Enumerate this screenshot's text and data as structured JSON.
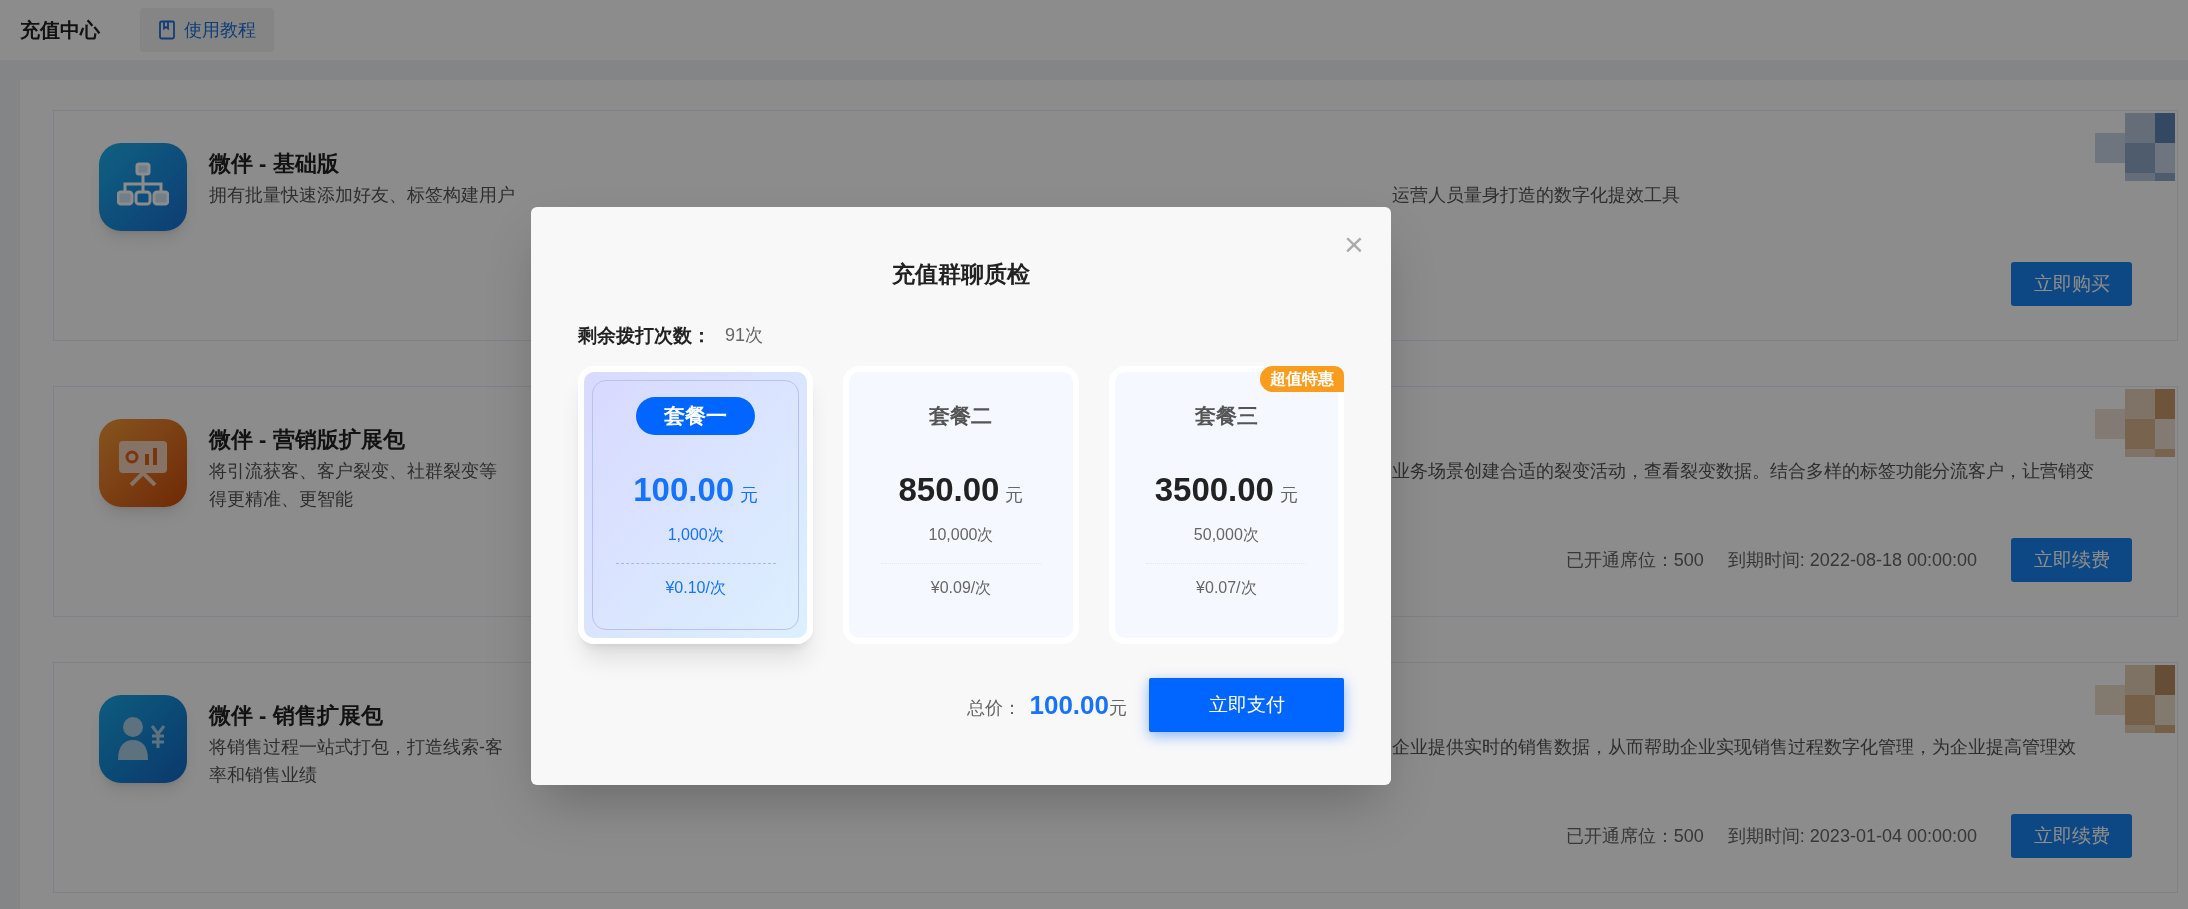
{
  "header": {
    "title": "充值中心",
    "tutorial_link": "使用教程"
  },
  "products": [
    {
      "kind": "network",
      "title": "微伴 - 基础版",
      "thumbnail": {
        "kind": "picture"
      },
      "lines": [
        {
          "left": "拥有批量快速添加好友、标签构建用户",
          "right": "运营人员量身打造的数字化提效工具"
        }
      ],
      "action": "立即购买"
    },
    {
      "kind": "presentation",
      "title": "微伴 - 营销版扩展包",
      "thumbnail": {
        "kind": "picture"
      },
      "lines": [
        {
          "left": "将引流获客、客户裂变、社群裂变等",
          "right": "业务场景创建合适的裂变活动，查看裂变数据。结合多样的标签功能分流客户，让营销变"
        },
        {
          "left": "得更精准、更智能"
        }
      ],
      "seats": "已开通席位：500",
      "expiry": "到期时间: 2022-08-18 00:00:00",
      "action": "立即续费"
    },
    {
      "kind": "sales",
      "title": "微伴 - 销售扩展包",
      "thumbnail": {
        "kind": "picture"
      },
      "lines": [
        {
          "left": "将销售过程一站式打包，打造线索-客",
          "right": "企业提供实时的销售数据，从而帮助企业实现销售过程数字化管理，为企业提高管理效"
        },
        {
          "left": "率和销售业绩"
        }
      ],
      "seats": "已开通席位：500",
      "expiry": "到期时间: 2023-01-04 00:00:00",
      "action": "立即续费"
    }
  ],
  "dialog": {
    "title": "充值群聊质检",
    "close": "×",
    "remaining_label": "剩余拨打次数：",
    "remaining_value": "91次",
    "plans": [
      {
        "name": "套餐一",
        "price": "100.00",
        "unit": "元",
        "count": "1,000次",
        "unit_price": "¥0.10/次",
        "selected": true
      },
      {
        "name": "套餐二",
        "price": "850.00",
        "unit": "元",
        "count": "10,000次",
        "unit_price": "¥0.09/次",
        "selected": false
      },
      {
        "name": "套餐三",
        "price": "3500.00",
        "unit": "元",
        "count": "50,000次",
        "unit_price": "¥0.07/次",
        "selected": false,
        "badge": "超值特惠"
      }
    ],
    "total_label": "总价：",
    "total_amount": "100.00",
    "total_unit": "元",
    "pay_button": "立即支付"
  }
}
